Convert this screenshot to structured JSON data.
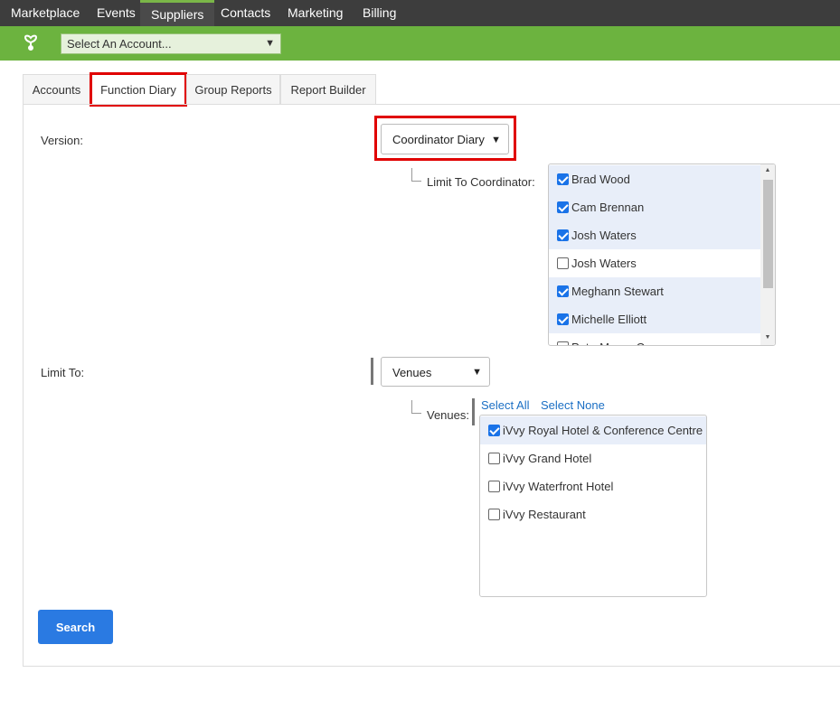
{
  "topnav": {
    "items": [
      {
        "label": "Marketplace"
      },
      {
        "label": "Events"
      },
      {
        "label": "Suppliers"
      },
      {
        "label": "Contacts"
      },
      {
        "label": "Marketing"
      },
      {
        "label": "Billing"
      }
    ],
    "active": "Suppliers"
  },
  "account": {
    "value": "Select An Account..."
  },
  "tabs": [
    {
      "label": "Accounts"
    },
    {
      "label": "Function Diary"
    },
    {
      "label": "Group Reports"
    },
    {
      "label": "Report Builder"
    }
  ],
  "form": {
    "version_label": "Version:",
    "version_value": "Coordinator Diary",
    "coordinator_label": "Limit To Coordinator:",
    "coordinators": [
      {
        "name": "Brad Wood",
        "checked": true
      },
      {
        "name": "Cam Brennan",
        "checked": true
      },
      {
        "name": "Josh Waters",
        "checked": true
      },
      {
        "name": "Josh Waters",
        "checked": false
      },
      {
        "name": "Meghann Stewart",
        "checked": true
      },
      {
        "name": "Michelle Elliott",
        "checked": true
      },
      {
        "name": "Pete-Maree Cameron",
        "checked": false
      }
    ],
    "limit_to_label": "Limit To:",
    "limit_to_value": "Venues",
    "venues_label": "Venues:",
    "select_all": "Select All",
    "select_none": "Select None",
    "venues": [
      {
        "name": "iVvy Royal Hotel & Conference Centre",
        "checked": true
      },
      {
        "name": "iVvy Grand Hotel",
        "checked": false
      },
      {
        "name": "iVvy Waterfront Hotel",
        "checked": false
      },
      {
        "name": "iVvy Restaurant",
        "checked": false
      }
    ],
    "search_label": "Search"
  },
  "colors": {
    "topnav_bg": "#3d3d3d",
    "brand_green": "#6cb33f",
    "highlight_red": "#e00000",
    "primary_blue": "#2a7ae2",
    "link_blue": "#1b6fc4"
  }
}
